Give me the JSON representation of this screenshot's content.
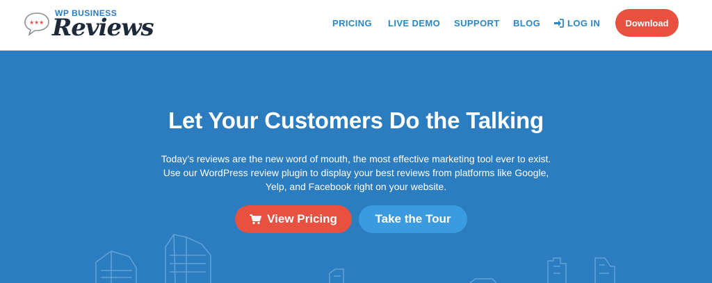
{
  "logo": {
    "top_text": "WP BUSINESS",
    "main_text": "Reviews",
    "icon": "speech-bubble-stars-icon"
  },
  "nav": {
    "items": [
      {
        "label": "PRICING"
      },
      {
        "label": "LIVE DEMO"
      },
      {
        "label": "SUPPORT"
      },
      {
        "label": "BLOG"
      }
    ],
    "login_label": "LOG IN",
    "login_icon": "sign-in-icon",
    "download_label": "Download"
  },
  "hero": {
    "title": "Let Your Customers Do the Talking",
    "description_lines": [
      "Today’s reviews are the new word of mouth, the most effective marketing tool ever to exist.",
      "Use our WordPress review plugin to display your best reviews from platforms like Google,",
      "Yelp, and Facebook right on your website."
    ],
    "primary_button": "View Pricing",
    "primary_icon": "shopping-cart-icon",
    "secondary_button": "Take the Tour"
  },
  "colors": {
    "brand_blue": "#2c7dbf",
    "accent_red": "#e8503f",
    "link_blue": "#2a86c5",
    "tour_blue": "#3a9be0"
  }
}
